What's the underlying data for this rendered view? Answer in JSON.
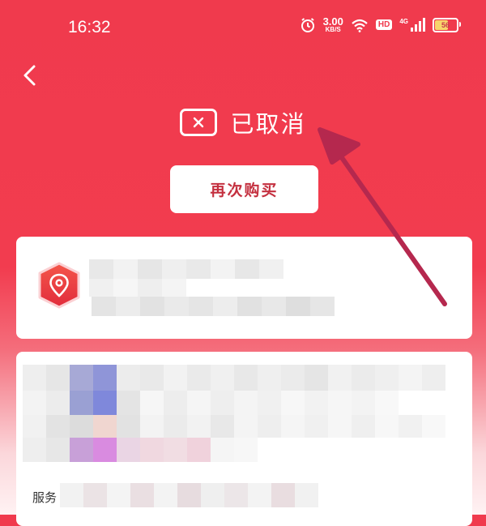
{
  "status_bar": {
    "time": "16:32",
    "net_speed_value": "3.00",
    "net_speed_unit": "KB/S",
    "hd": "HD",
    "signal": "4G",
    "battery": "56"
  },
  "order": {
    "status": "已取消",
    "buy_again_label": "再次购买"
  },
  "goods": {
    "service_label": "服务"
  },
  "colors": {
    "header_red": "#f03a4d",
    "annotation_arrow": "#b5284e",
    "button_text": "#c4303f"
  },
  "icons": [
    "back-arrow-icon",
    "alarm-icon",
    "wifi-icon",
    "signal-icon",
    "battery-icon",
    "cancel-x-icon",
    "location-pin-icon"
  ]
}
